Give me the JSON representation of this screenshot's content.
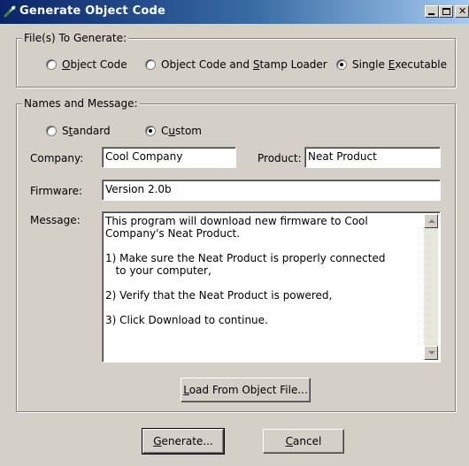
{
  "window": {
    "title": "Generate Object Code",
    "controls": [
      "minimize",
      "maximize",
      "close"
    ]
  },
  "files_group": {
    "legend": "File(s) To Generate:",
    "options": [
      {
        "pre": "",
        "accel": "O",
        "post": "bject Code",
        "selected": false
      },
      {
        "pre": "Object Code and ",
        "accel": "S",
        "post": "tamp Loader",
        "selected": false
      },
      {
        "pre": "Single ",
        "accel": "E",
        "post": "xecutable",
        "selected": true
      }
    ]
  },
  "names_group": {
    "legend": "Names and Message:",
    "mode_options": [
      {
        "pre": "S",
        "accel": "t",
        "post": "andard",
        "selected": false
      },
      {
        "pre": "C",
        "accel": "u",
        "post": "stom",
        "selected": true
      }
    ],
    "company_label": "Company:",
    "company_value": "Cool Company",
    "product_label": "Product:",
    "product_value": "Neat Product",
    "firmware_label": "Firmware:",
    "firmware_value": "Version 2.0b",
    "message_label": "Message:",
    "message_value": "This program will download new firmware to Cool Company's Neat Product.\n\n1) Make sure the Neat Product is properly connected\n   to your computer,\n\n2) Verify that the Neat Product is powered,\n\n3) Click Download to continue.",
    "load_button": {
      "pre": "",
      "accel": "L",
      "post": "oad From Object File..."
    }
  },
  "buttons": {
    "generate": {
      "pre": "",
      "accel": "G",
      "post": "enerate..."
    },
    "cancel": {
      "pre": "",
      "accel": "C",
      "post": "ancel"
    }
  }
}
